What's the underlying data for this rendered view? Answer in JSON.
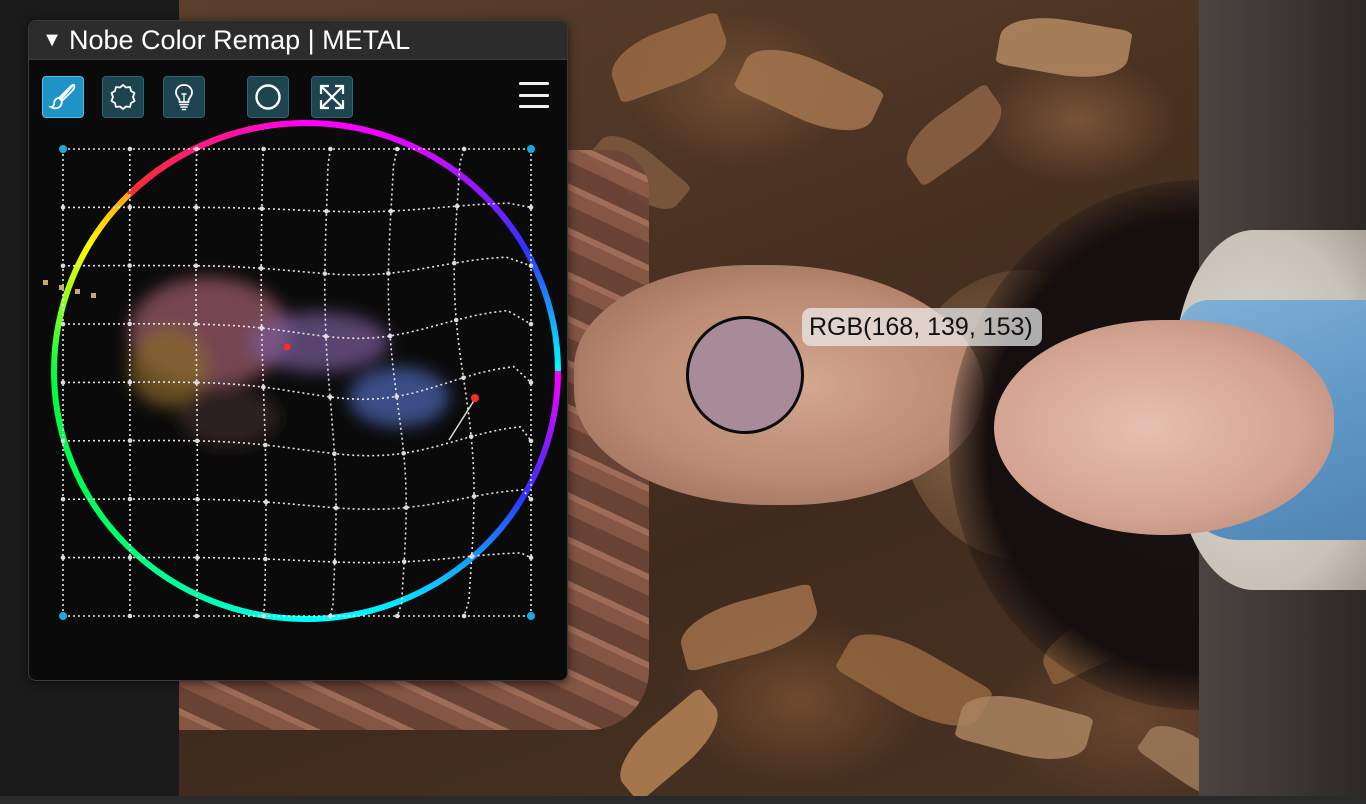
{
  "panel": {
    "title": "Nobe Color Remap | METAL",
    "toolbar": [
      {
        "icon": "brush-icon",
        "active": true
      },
      {
        "icon": "gear-badge-icon",
        "active": false
      },
      {
        "icon": "lightbulb-icon",
        "active": false
      },
      {
        "icon": "circle-icon",
        "active": false
      },
      {
        "icon": "expand-arrows-icon",
        "active": false
      }
    ],
    "menu_icon": "hamburger-menu-icon"
  },
  "probe": {
    "label": "RGB(168, 139, 153)",
    "color": "#a88b99"
  },
  "colors": {
    "active_tool": "#1e93c5",
    "tool_bg": "#1e4450",
    "grid_corner": "#19a9e0",
    "picked_point": "#ff2a2a"
  }
}
